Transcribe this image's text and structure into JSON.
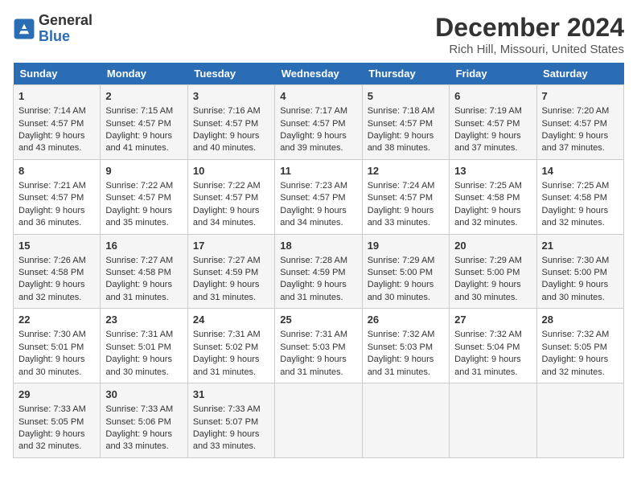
{
  "logo": {
    "line1": "General",
    "line2": "Blue"
  },
  "title": "December 2024",
  "subtitle": "Rich Hill, Missouri, United States",
  "days_of_week": [
    "Sunday",
    "Monday",
    "Tuesday",
    "Wednesday",
    "Thursday",
    "Friday",
    "Saturday"
  ],
  "weeks": [
    [
      {
        "day": "1",
        "sunrise": "Sunrise: 7:14 AM",
        "sunset": "Sunset: 4:57 PM",
        "daylight": "Daylight: 9 hours and 43 minutes."
      },
      {
        "day": "2",
        "sunrise": "Sunrise: 7:15 AM",
        "sunset": "Sunset: 4:57 PM",
        "daylight": "Daylight: 9 hours and 41 minutes."
      },
      {
        "day": "3",
        "sunrise": "Sunrise: 7:16 AM",
        "sunset": "Sunset: 4:57 PM",
        "daylight": "Daylight: 9 hours and 40 minutes."
      },
      {
        "day": "4",
        "sunrise": "Sunrise: 7:17 AM",
        "sunset": "Sunset: 4:57 PM",
        "daylight": "Daylight: 9 hours and 39 minutes."
      },
      {
        "day": "5",
        "sunrise": "Sunrise: 7:18 AM",
        "sunset": "Sunset: 4:57 PM",
        "daylight": "Daylight: 9 hours and 38 minutes."
      },
      {
        "day": "6",
        "sunrise": "Sunrise: 7:19 AM",
        "sunset": "Sunset: 4:57 PM",
        "daylight": "Daylight: 9 hours and 37 minutes."
      },
      {
        "day": "7",
        "sunrise": "Sunrise: 7:20 AM",
        "sunset": "Sunset: 4:57 PM",
        "daylight": "Daylight: 9 hours and 37 minutes."
      }
    ],
    [
      {
        "day": "8",
        "sunrise": "Sunrise: 7:21 AM",
        "sunset": "Sunset: 4:57 PM",
        "daylight": "Daylight: 9 hours and 36 minutes."
      },
      {
        "day": "9",
        "sunrise": "Sunrise: 7:22 AM",
        "sunset": "Sunset: 4:57 PM",
        "daylight": "Daylight: 9 hours and 35 minutes."
      },
      {
        "day": "10",
        "sunrise": "Sunrise: 7:22 AM",
        "sunset": "Sunset: 4:57 PM",
        "daylight": "Daylight: 9 hours and 34 minutes."
      },
      {
        "day": "11",
        "sunrise": "Sunrise: 7:23 AM",
        "sunset": "Sunset: 4:57 PM",
        "daylight": "Daylight: 9 hours and 34 minutes."
      },
      {
        "day": "12",
        "sunrise": "Sunrise: 7:24 AM",
        "sunset": "Sunset: 4:57 PM",
        "daylight": "Daylight: 9 hours and 33 minutes."
      },
      {
        "day": "13",
        "sunrise": "Sunrise: 7:25 AM",
        "sunset": "Sunset: 4:58 PM",
        "daylight": "Daylight: 9 hours and 32 minutes."
      },
      {
        "day": "14",
        "sunrise": "Sunrise: 7:25 AM",
        "sunset": "Sunset: 4:58 PM",
        "daylight": "Daylight: 9 hours and 32 minutes."
      }
    ],
    [
      {
        "day": "15",
        "sunrise": "Sunrise: 7:26 AM",
        "sunset": "Sunset: 4:58 PM",
        "daylight": "Daylight: 9 hours and 32 minutes."
      },
      {
        "day": "16",
        "sunrise": "Sunrise: 7:27 AM",
        "sunset": "Sunset: 4:58 PM",
        "daylight": "Daylight: 9 hours and 31 minutes."
      },
      {
        "day": "17",
        "sunrise": "Sunrise: 7:27 AM",
        "sunset": "Sunset: 4:59 PM",
        "daylight": "Daylight: 9 hours and 31 minutes."
      },
      {
        "day": "18",
        "sunrise": "Sunrise: 7:28 AM",
        "sunset": "Sunset: 4:59 PM",
        "daylight": "Daylight: 9 hours and 31 minutes."
      },
      {
        "day": "19",
        "sunrise": "Sunrise: 7:29 AM",
        "sunset": "Sunset: 5:00 PM",
        "daylight": "Daylight: 9 hours and 30 minutes."
      },
      {
        "day": "20",
        "sunrise": "Sunrise: 7:29 AM",
        "sunset": "Sunset: 5:00 PM",
        "daylight": "Daylight: 9 hours and 30 minutes."
      },
      {
        "day": "21",
        "sunrise": "Sunrise: 7:30 AM",
        "sunset": "Sunset: 5:00 PM",
        "daylight": "Daylight: 9 hours and 30 minutes."
      }
    ],
    [
      {
        "day": "22",
        "sunrise": "Sunrise: 7:30 AM",
        "sunset": "Sunset: 5:01 PM",
        "daylight": "Daylight: 9 hours and 30 minutes."
      },
      {
        "day": "23",
        "sunrise": "Sunrise: 7:31 AM",
        "sunset": "Sunset: 5:01 PM",
        "daylight": "Daylight: 9 hours and 30 minutes."
      },
      {
        "day": "24",
        "sunrise": "Sunrise: 7:31 AM",
        "sunset": "Sunset: 5:02 PM",
        "daylight": "Daylight: 9 hours and 31 minutes."
      },
      {
        "day": "25",
        "sunrise": "Sunrise: 7:31 AM",
        "sunset": "Sunset: 5:03 PM",
        "daylight": "Daylight: 9 hours and 31 minutes."
      },
      {
        "day": "26",
        "sunrise": "Sunrise: 7:32 AM",
        "sunset": "Sunset: 5:03 PM",
        "daylight": "Daylight: 9 hours and 31 minutes."
      },
      {
        "day": "27",
        "sunrise": "Sunrise: 7:32 AM",
        "sunset": "Sunset: 5:04 PM",
        "daylight": "Daylight: 9 hours and 31 minutes."
      },
      {
        "day": "28",
        "sunrise": "Sunrise: 7:32 AM",
        "sunset": "Sunset: 5:05 PM",
        "daylight": "Daylight: 9 hours and 32 minutes."
      }
    ],
    [
      {
        "day": "29",
        "sunrise": "Sunrise: 7:33 AM",
        "sunset": "Sunset: 5:05 PM",
        "daylight": "Daylight: 9 hours and 32 minutes."
      },
      {
        "day": "30",
        "sunrise": "Sunrise: 7:33 AM",
        "sunset": "Sunset: 5:06 PM",
        "daylight": "Daylight: 9 hours and 33 minutes."
      },
      {
        "day": "31",
        "sunrise": "Sunrise: 7:33 AM",
        "sunset": "Sunset: 5:07 PM",
        "daylight": "Daylight: 9 hours and 33 minutes."
      },
      null,
      null,
      null,
      null
    ]
  ]
}
